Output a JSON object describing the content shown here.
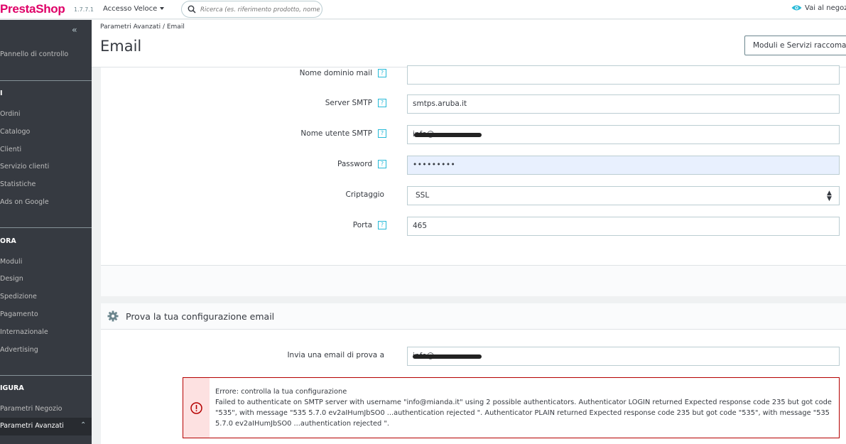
{
  "topbar": {
    "logo_presta": "Presta",
    "logo_shop": "Shop",
    "version": "1.7.7.1",
    "quick_access": "Accesso Veloce",
    "search_placeholder": "Ricerca (es. riferimento prodotto, nome",
    "view_shop": "Vai al negoz"
  },
  "sidebar": {
    "dashboard": "Pannello di controllo",
    "sections": [
      {
        "title": "I",
        "items": [
          "Ordini",
          "Catalogo",
          "Clienti",
          "Servizio clienti",
          "Statistiche",
          "Ads on Google"
        ]
      },
      {
        "title": "ORA",
        "items": [
          "Moduli",
          "Design",
          "Spedizione",
          "Pagamento",
          "Internazionale",
          "Advertising"
        ]
      },
      {
        "title": "IGURA",
        "items": [
          "Parametri Negozio",
          "Parametri Avanzati"
        ]
      }
    ]
  },
  "header": {
    "breadcrumb": "Parametri Avanzati  /  Email",
    "title": "Email",
    "recommended_button": "Moduli e Servizi raccoma"
  },
  "smtp_form": {
    "domain_label": "Nome dominio mail",
    "domain_value": "",
    "server_label": "Server SMTP",
    "server_value": "smtps.aruba.it",
    "username_label": "Nome utente SMTP",
    "username_value": "info@",
    "password_label": "Password",
    "password_value": "•••••••••",
    "encryption_label": "Criptaggio",
    "encryption_value": "SSL",
    "port_label": "Porta",
    "port_value": "465"
  },
  "test_panel": {
    "title": "Prova la tua configurazione email",
    "send_label": "Invia una email di prova a",
    "send_value": "info@",
    "error_title": "Errore: controlla la tua configurazione",
    "error_message": "Failed to authenticate on SMTP server with username \"info@mianda.it\" using 2 possible authenticators. Authenticator LOGIN returned Expected response code 235 but got code \"535\", with message \"535 5.7.0 ev2aIHumJbSO0 ...authentication rejected \". Authenticator PLAIN returned Expected response code 235 but got code \"535\", with message \"535 5.7.0 ev2aIHumJbSO0 ...authentication rejected \"."
  },
  "colors": {
    "brand": "#df0067",
    "sidebar_bg": "#363a41",
    "accent": "#25b9d7",
    "error": "#b50000"
  },
  "icons": [
    "search-icon",
    "eye-icon",
    "double-chevron-left-icon",
    "chevron-up-icon",
    "help-icon",
    "gear-icon",
    "alert-circle-icon",
    "select-arrows-icon"
  ]
}
